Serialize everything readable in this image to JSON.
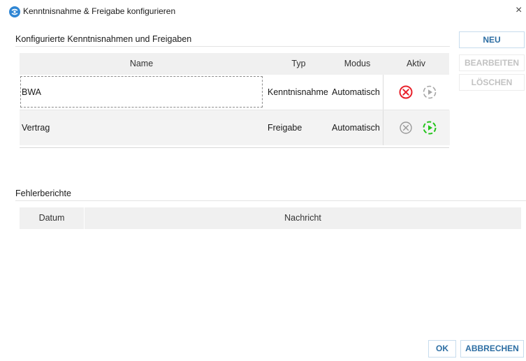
{
  "window": {
    "title": "Kenntnisnahme & Freigabe konfigurieren",
    "close_glyph": "×"
  },
  "config_section": {
    "title": "Konfigurierte Kenntnisnahmen und Freigaben",
    "columns": [
      "Name",
      "Typ",
      "Modus",
      "Aktiv"
    ],
    "rows": [
      {
        "name": "BWA",
        "typ": "Kenntnisnahme",
        "modus": "Automatisch",
        "deactivate_icon": "deactivate-icon",
        "deactivate_state": "active-red",
        "activate_icon": "activate-icon",
        "activate_state": "inactive-gray"
      },
      {
        "name": "Vertrag",
        "typ": "Freigabe",
        "modus": "Automatisch",
        "deactivate_icon": "deactivate-icon",
        "deactivate_state": "inactive-gray",
        "activate_icon": "activate-icon",
        "activate_state": "active-green"
      }
    ]
  },
  "side_buttons": {
    "new_label": "NEU",
    "edit_label": "BEARBEITEN",
    "delete_label": "LÖSCHEN"
  },
  "errors_section": {
    "title": "Fehlerberichte",
    "columns": [
      "Datum",
      "Nachricht"
    ]
  },
  "footer": {
    "ok_label": "OK",
    "cancel_label": "ABBRECHEN"
  },
  "colors": {
    "accent": "#2d6ea3",
    "red": "#e8202a",
    "green": "#22c41a",
    "gray_icon": "#9a9a9a"
  }
}
